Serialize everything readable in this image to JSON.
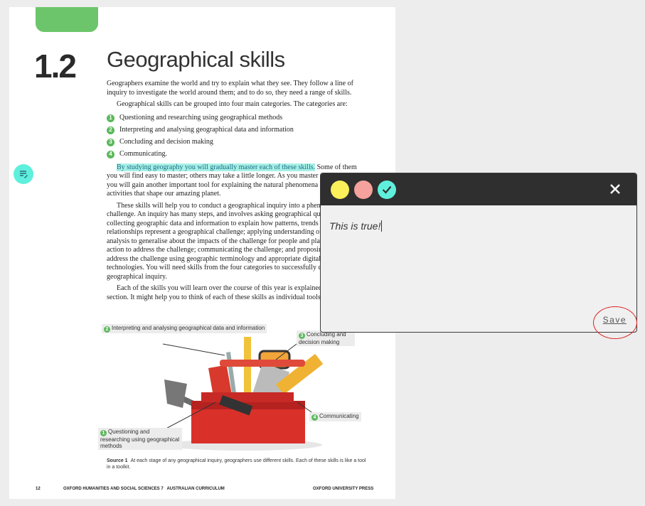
{
  "page": {
    "section_number": "1.2",
    "section_title": "Geographical skills",
    "intro": "Geographers examine the world and try to explain what they see. They follow a line of inquiry to investigate the world around them; and to do so, they need a range of skills.",
    "categories_intro": "Geographical skills can be grouped into four main categories. The categories are:",
    "list": [
      {
        "num": "1",
        "text": "Questioning and researching using geographical methods"
      },
      {
        "num": "2",
        "text": "Interpreting and analysing geographical data and information"
      },
      {
        "num": "3",
        "text": "Concluding and decision making"
      },
      {
        "num": "4",
        "text": "Communicating."
      }
    ],
    "highlight": "By studying geography you will gradually master each of these skills.",
    "para2_rest": " Some of them you will find easy to master; others may take a little longer. As you master each new skill, you will gain another important tool for explaining the natural phenomena and human activities that shape our amazing planet.",
    "para3": "These skills will help you to conduct a geographical inquiry into a phenomenon or challenge. An inquiry has many steps, and involves asking geographical questions; collecting geographic data and information to explain how patterns, trends and relationships represent a geographical challenge; applying understanding of the data in the analysis to generalise about the impacts of the challenge for people and places; proposing action to address the challenge; communicating the challenge; and proposing solutions to address the challenge using geographic terminology and appropriate digital and spatial technologies. You will need skills from the four categories to successfully complete a geographical inquiry.",
    "para4": "Each of the skills you will learn over the course of this year is explained in this section. It might help you to think of each of these skills as individual tools in a toolkit.",
    "callouts": {
      "c2": {
        "num": "2",
        "text": "Interpreting and analysing geographical data and information"
      },
      "c3": {
        "num": "3",
        "text": "Concluding and decision making"
      },
      "c4": {
        "num": "4",
        "text": "Communicating"
      },
      "c1": {
        "num": "1",
        "text": "Questioning and researching using geographical methods"
      }
    },
    "caption_label": "Source 1",
    "caption_text": "At each stage of any geographical inquiry, geographers use different skills. Each of these skills is like a tool in a toolkit.",
    "footer_page": "12",
    "footer_book": "OXFORD HUMANITIES AND SOCIAL SCIENCES 7   AUSTRALIAN CURRICULUM",
    "footer_publisher": "OXFORD UNIVERSITY PRESS"
  },
  "note_popup": {
    "text": "This is true!",
    "save_label": "Save",
    "colors": {
      "yellow": "#fbef5a",
      "pink": "#f5a19d",
      "teal": "#5ff0dd"
    }
  }
}
